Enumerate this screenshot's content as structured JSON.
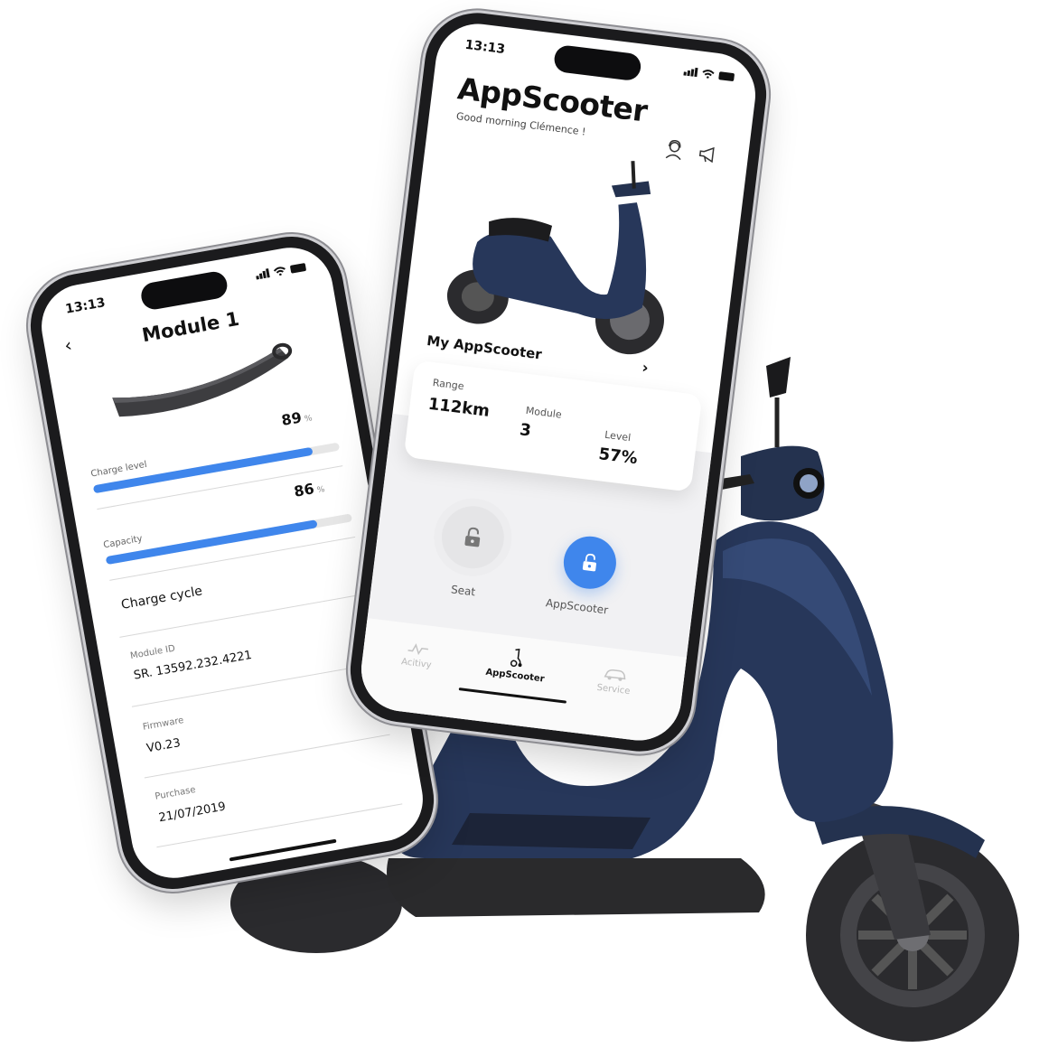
{
  "colors": {
    "accent": "#3f86ec",
    "scooter_body": "#27375a",
    "tire": "#2b2b2e"
  },
  "module_phone": {
    "status_time": "13:13",
    "back_icon": "chevron-left-icon",
    "title": "Module 1",
    "charge": {
      "label": "Charge level",
      "value": "89",
      "unit": "%",
      "fraction": 0.89
    },
    "capacity": {
      "label": "Capacity",
      "value": "86",
      "unit": "%",
      "fraction": 0.86
    },
    "charge_cycle_label": "Charge cycle",
    "module_id": {
      "label": "Module ID",
      "value": "SR. 13592.232.4221"
    },
    "firmware": {
      "label": "Firmware",
      "value": "V0.23"
    },
    "purchase": {
      "label": "Purchase",
      "value": "21/07/2019"
    }
  },
  "main_phone": {
    "status_time": "13:13",
    "title": "AppScooter",
    "greeting": "Good morning Clémence !",
    "header_icons": [
      "support-agent-icon",
      "megaphone-icon"
    ],
    "my_scooter_label": "My AppScooter",
    "stats": {
      "range": {
        "label": "Range",
        "value": "112km"
      },
      "module": {
        "label": "Module",
        "value": "3"
      },
      "level": {
        "label": "Level",
        "value": "57%"
      }
    },
    "seat_label": "Seat",
    "appscooter_lock_label": "AppScooter",
    "tabs": [
      {
        "label": "Acitivy",
        "icon": "activity-icon",
        "active": false
      },
      {
        "label": "AppScooter",
        "icon": "scooter-icon",
        "active": true
      },
      {
        "label": "Service",
        "icon": "car-service-icon",
        "active": false
      }
    ]
  }
}
